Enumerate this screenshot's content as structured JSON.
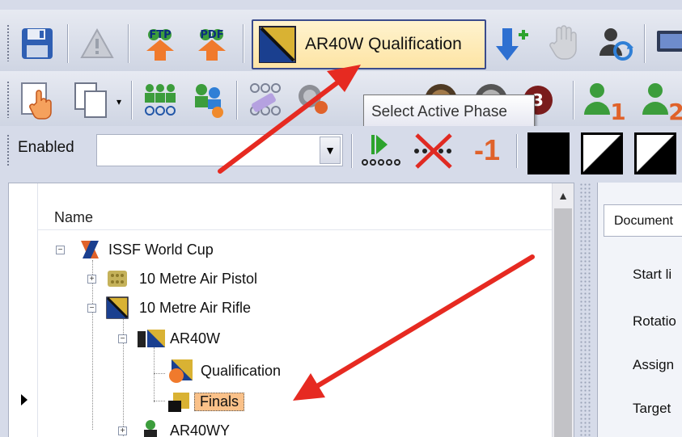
{
  "toolbar1": {
    "active_phase_label": "AR40W Qualification"
  },
  "tooltip": {
    "text": "Select Active Phase"
  },
  "toolbar3": {
    "filter_label": "Enabled",
    "filter_value": "",
    "minus_one_label": "-1"
  },
  "tree": {
    "header": "Name",
    "nodes": [
      {
        "label": "ISSF World Cup"
      },
      {
        "label": "10 Metre Air Pistol"
      },
      {
        "label": "10 Metre Air Rifle"
      },
      {
        "label": "AR40W"
      },
      {
        "label": "Qualification"
      },
      {
        "label": "Finals"
      },
      {
        "label": "AR40WY"
      }
    ]
  },
  "right_panel": {
    "tab_label": "Document",
    "labels": [
      "Start li",
      "Rotatio",
      "Assign",
      "Target"
    ]
  },
  "colors": {
    "selected_row": "#fac189",
    "annotation_arrow": "#e62a21",
    "phase_button_border": "#3b4c8c"
  }
}
